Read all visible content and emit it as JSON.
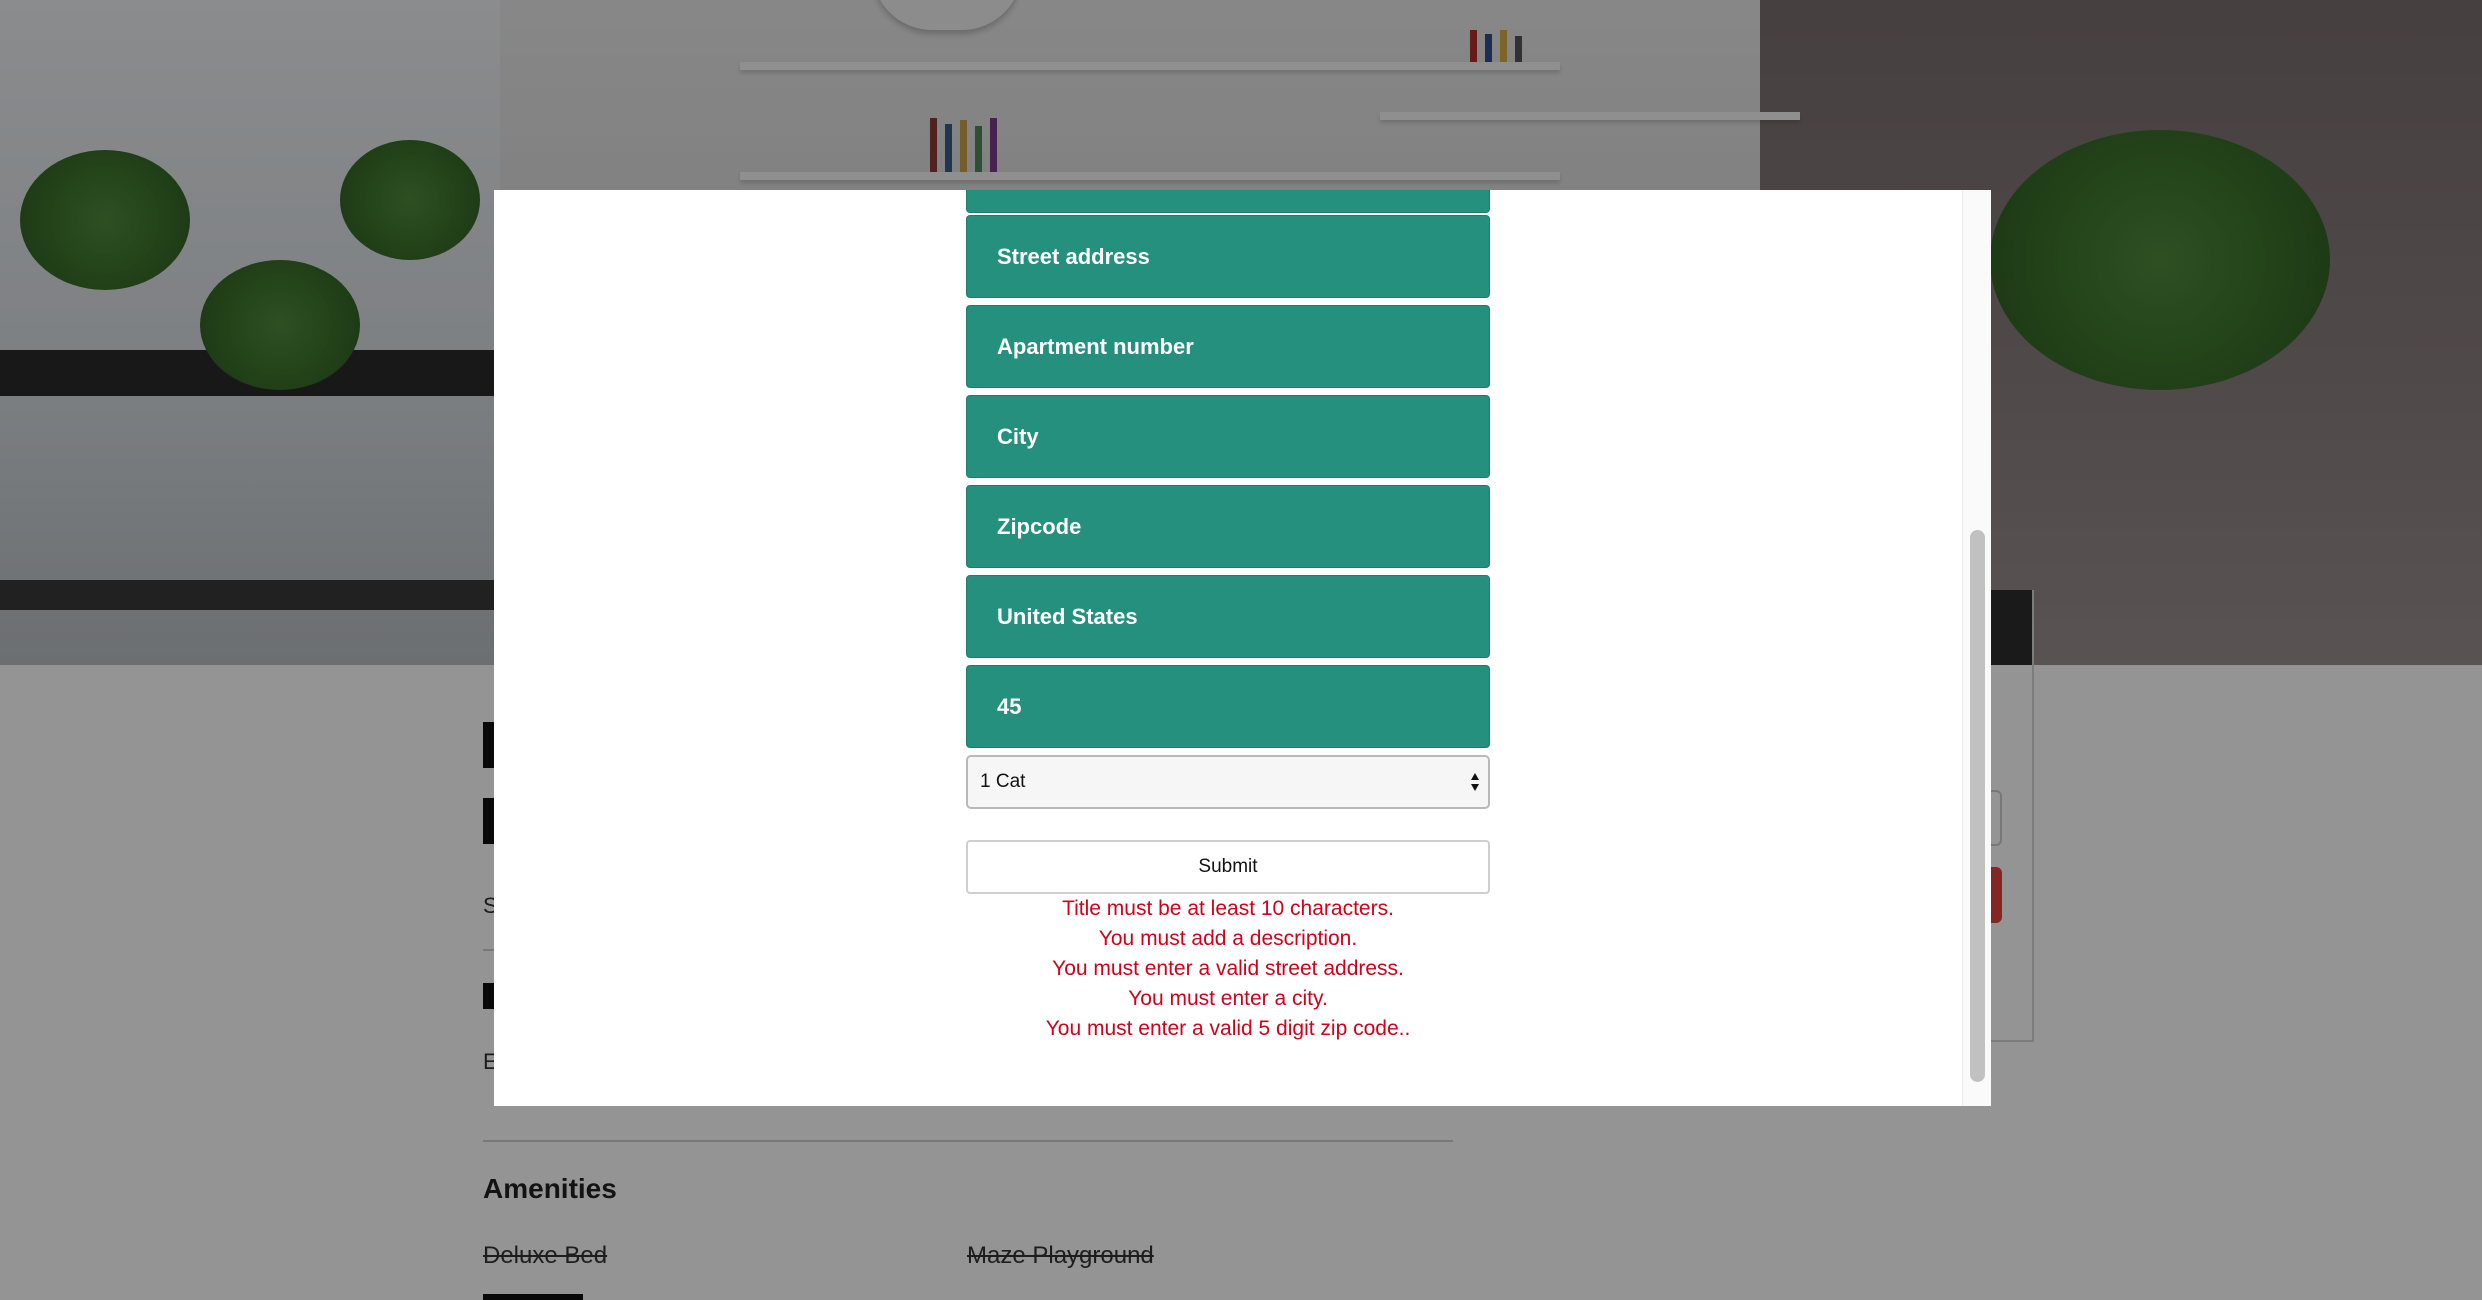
{
  "form": {
    "fields": [
      {
        "value": "Street address"
      },
      {
        "value": "Apartment number"
      },
      {
        "value": "City"
      },
      {
        "value": "Zipcode"
      },
      {
        "value": "United States"
      },
      {
        "value": "45"
      }
    ],
    "cat_select": {
      "selected": "1 Cat"
    },
    "submit_label": "Submit",
    "errors": [
      "Title must be at least 10 characters.",
      "You must add a description.",
      "You must enter a valid street address.",
      "You must enter a city.",
      "You must enter a valid 5 digit zip code.."
    ]
  },
  "page": {
    "amenities_title": "Amenities",
    "amenities": [
      "Deluxe Bed",
      "Maze Playground"
    ]
  },
  "colors": {
    "field_bg": "#25907e",
    "error_text": "#d0021b",
    "accent_red": "#e2433f"
  },
  "icons": {
    "select_arrows": "updown-arrows-icon"
  }
}
